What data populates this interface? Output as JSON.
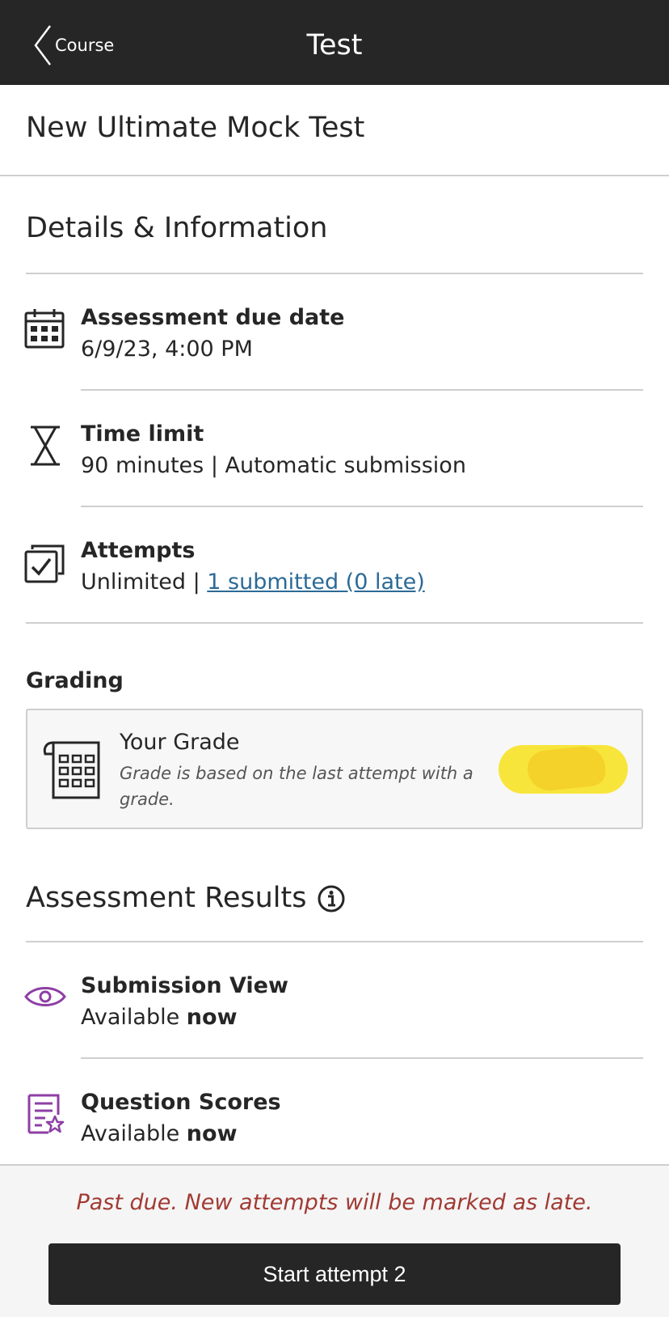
{
  "header": {
    "back_label": "Course",
    "title": "Test"
  },
  "page_title": "New Ultimate Mock Test",
  "details": {
    "title": "Details & Information",
    "due_date": {
      "label": "Assessment due date",
      "value": "6/9/23, 4:00 PM",
      "icon": "calendar-icon"
    },
    "time_limit": {
      "label": "Time limit",
      "value": "90 minutes | Automatic submission",
      "icon": "hourglass-icon"
    },
    "attempts": {
      "label": "Attempts",
      "value_prefix": "Unlimited | ",
      "link": "1 submitted (0 late)",
      "icon": "attempts-icon"
    }
  },
  "grading": {
    "label": "Grading",
    "card_title": "Your Grade",
    "card_description": "Grade is based on the last attempt with a grade.",
    "pill_color": "#f8e53b"
  },
  "results": {
    "title": "Assessment Results",
    "submission_view": {
      "label": "Submission View",
      "value_prefix": "Available ",
      "value_bold": "now",
      "icon": "eye-icon"
    },
    "question_scores": {
      "label": "Question Scores",
      "value_prefix": "Available ",
      "value_bold": "now",
      "icon": "scores-icon"
    }
  },
  "footer": {
    "late_message": "Past due. New attempts will be marked as late.",
    "start_button": "Start attempt 2"
  },
  "colors": {
    "header_bg": "#262626",
    "link": "#2b6a96",
    "accent_purple": "#8e3fa5",
    "late_red": "#a13a33"
  }
}
